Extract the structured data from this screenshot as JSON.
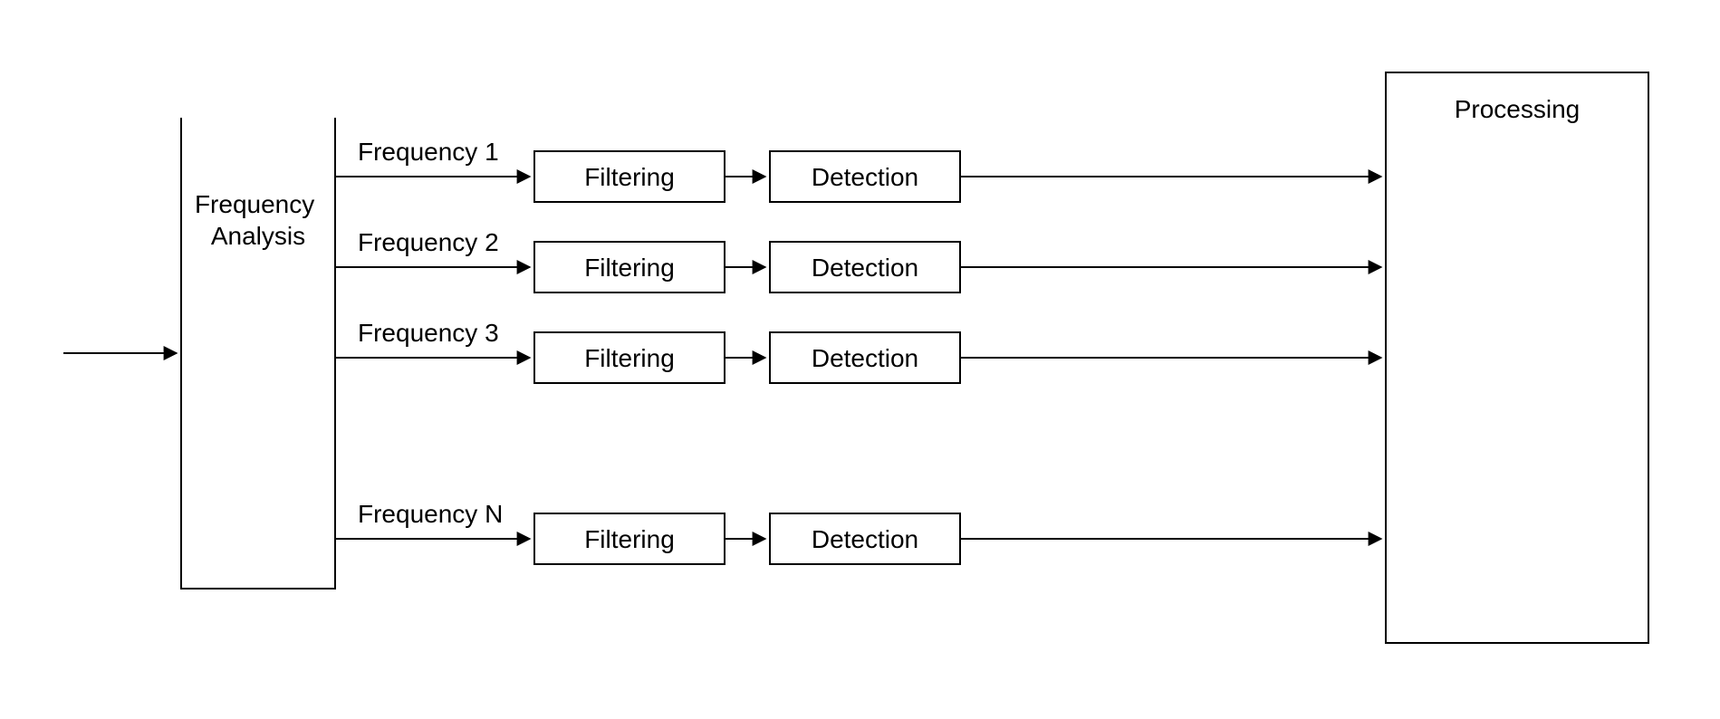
{
  "diagram": {
    "left_block": "Frequency\nAnalysis",
    "right_block": "Processing",
    "rows": [
      {
        "freq": "Frequency 1",
        "stage1": "Filtering",
        "stage2": "Detection"
      },
      {
        "freq": "Frequency 2",
        "stage1": "Filtering",
        "stage2": "Detection"
      },
      {
        "freq": "Frequency 3",
        "stage1": "Filtering",
        "stage2": "Detection"
      },
      {
        "freq": "Frequency N",
        "stage1": "Filtering",
        "stage2": "Detection"
      }
    ]
  }
}
